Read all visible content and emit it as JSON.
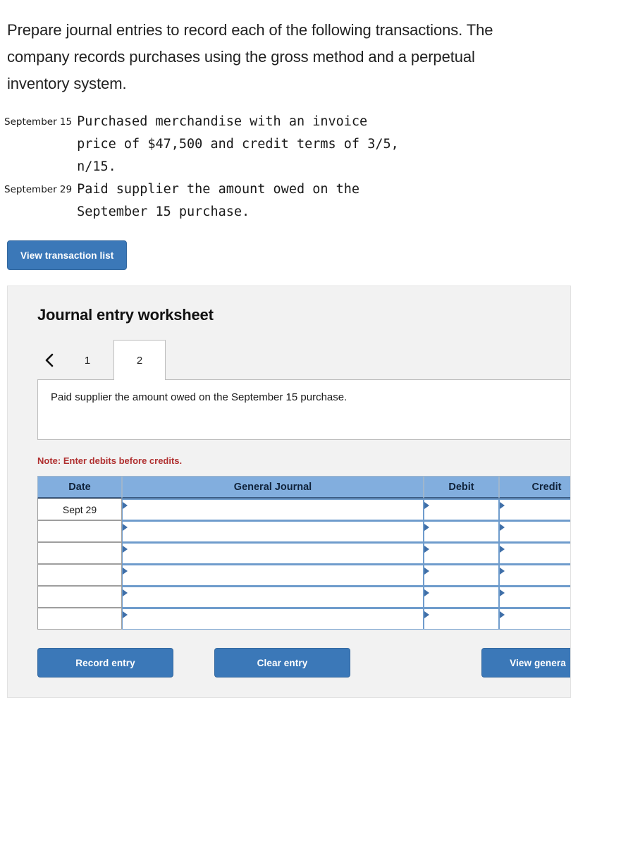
{
  "prompt": "Prepare journal entries to record each of the following transactions. The company records purchases using the gross method and a perpetual inventory system.",
  "transactions": [
    {
      "date": "September 15",
      "description": "Purchased merchandise with an invoice\nprice of $47,500 and credit terms of 3/5,\nn/15."
    },
    {
      "date": "September 29",
      "description": "Paid supplier the amount owed on the\nSeptember 15 purchase."
    }
  ],
  "view_transaction_list_label": "View transaction list",
  "worksheet": {
    "title": "Journal entry worksheet",
    "prev_icon": "chevron-left-icon",
    "tabs": [
      {
        "label": "1",
        "active": false
      },
      {
        "label": "2",
        "active": true
      }
    ],
    "active_transaction_description": "Paid supplier the amount owed on the September 15 purchase.",
    "note": "Note: Enter debits before credits.",
    "table": {
      "columns": [
        "Date",
        "General Journal",
        "Debit",
        "Credit"
      ],
      "rows": [
        {
          "date": "Sept 29",
          "general_journal": "",
          "debit": "",
          "credit": ""
        },
        {
          "date": "",
          "general_journal": "",
          "debit": "",
          "credit": ""
        },
        {
          "date": "",
          "general_journal": "",
          "debit": "",
          "credit": ""
        },
        {
          "date": "",
          "general_journal": "",
          "debit": "",
          "credit": ""
        },
        {
          "date": "",
          "general_journal": "",
          "debit": "",
          "credit": ""
        },
        {
          "date": "",
          "general_journal": "",
          "debit": "",
          "credit": ""
        }
      ]
    },
    "buttons": {
      "record": "Record entry",
      "clear": "Clear entry",
      "view_general": "View genera"
    }
  },
  "colors": {
    "button_blue": "#3b78b8",
    "table_header_blue": "#82aede",
    "cell_border_blue": "#6f9ccc",
    "note_red": "#b03030",
    "panel_gray": "#f2f2f2"
  }
}
